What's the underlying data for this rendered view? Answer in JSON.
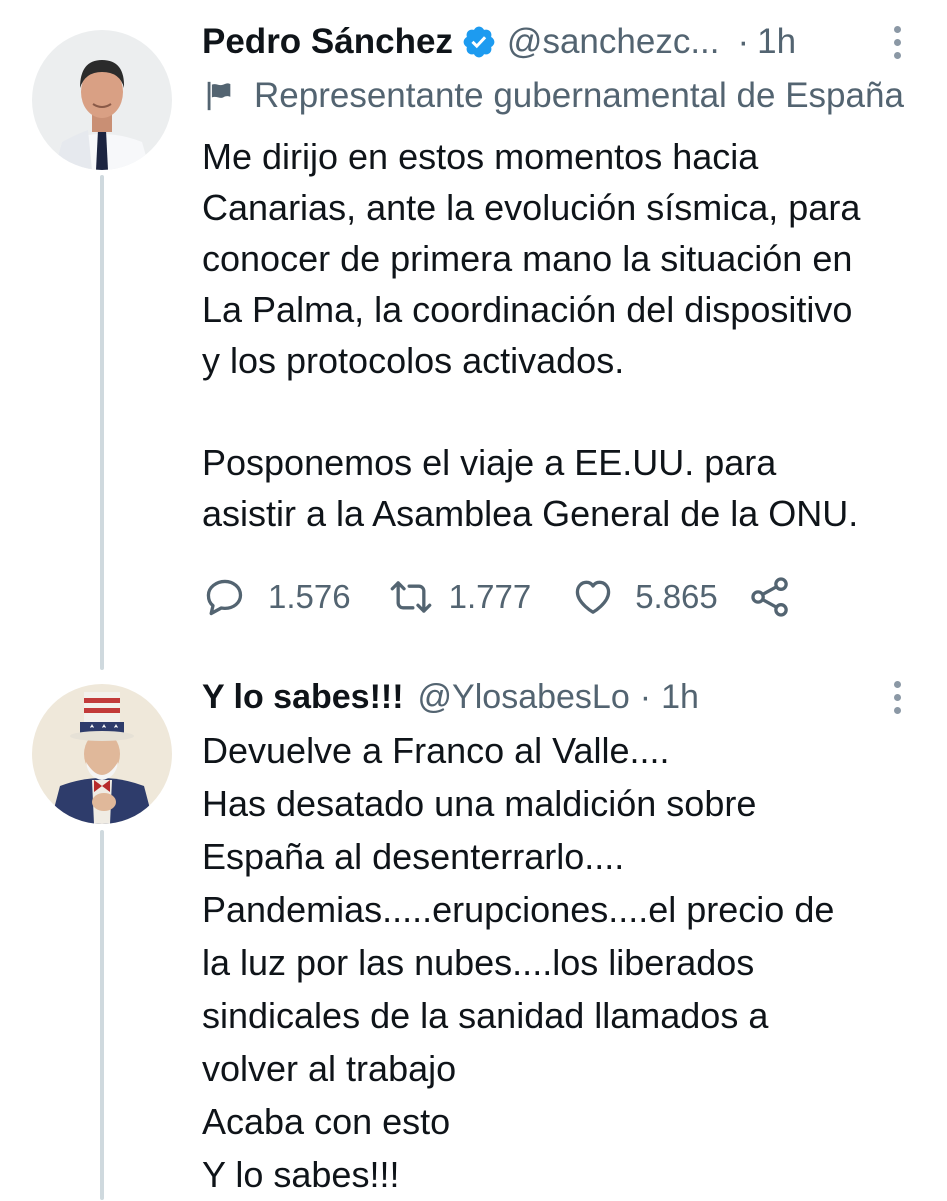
{
  "tweets": [
    {
      "author_name": "Pedro Sánchez",
      "handle": "@sanchezc...",
      "separator": "·",
      "time": "1h",
      "verified": true,
      "account_label": "Representante gubernamental de España",
      "text": "Me dirijo en estos momentos hacia\nCanarias, ante la evolución sísmica, para\nconocer de primera mano la situación en\nLa Palma, la coordinación del dispositivo\ny los protocolos activados.\n\nPosponemos el viaje a EE.UU. para\nasistir a la Asamblea General de la ONU.",
      "replies": "1.576",
      "retweets": "1.777",
      "likes": "5.865"
    },
    {
      "author_name": "Y lo sabes!!!",
      "handle": "@YlosabesLo",
      "separator": "·",
      "time": "1h",
      "verified": false,
      "text": "Devuelve a Franco al Valle....\nHas desatado una maldición sobre\nEspaña al desenterrarlo....\nPandemias.....erupciones....el precio de\nla luz por las nubes....los liberados\nsindicales de la sanidad llamados a\nvolver al trabajo\nAcaba con esto\nY lo sabes!!!"
    }
  ],
  "colors": {
    "text": "#0f1419",
    "secondary": "#536471",
    "verified": "#1d9bf0",
    "thread_line": "#cfd9de"
  },
  "icons": {
    "reply": "reply-icon",
    "retweet": "retweet-icon",
    "like": "heart-icon",
    "share": "share-icon",
    "more": "more-options-icon",
    "label": "flag-icon",
    "verified": "verified-badge-icon"
  }
}
